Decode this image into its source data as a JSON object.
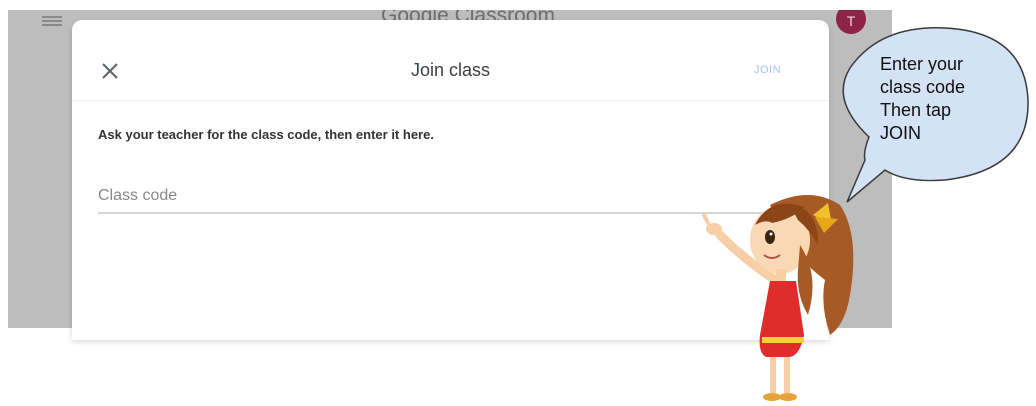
{
  "app": {
    "title": "Google Classroom",
    "avatar_letter": "T"
  },
  "dialog": {
    "title": "Join class",
    "join_label": "JOIN",
    "close_label": "✕",
    "instruction": "Ask your teacher for the class code, then enter it here.",
    "input": {
      "placeholder": "Class code",
      "value": ""
    }
  },
  "callout": {
    "text": "Enter your\nclass code\nThen tap\nJOIN"
  },
  "colors": {
    "backdrop": "#bdbdbd",
    "avatar": "#8e2348",
    "join_disabled": "#a8c4f2",
    "bubble_fill": "#d3e2f4",
    "dress_red": "#e12c2c",
    "hair_brown": "#a65a25"
  },
  "icons": {
    "menu": "hamburger-menu-icon",
    "close": "close-icon"
  }
}
